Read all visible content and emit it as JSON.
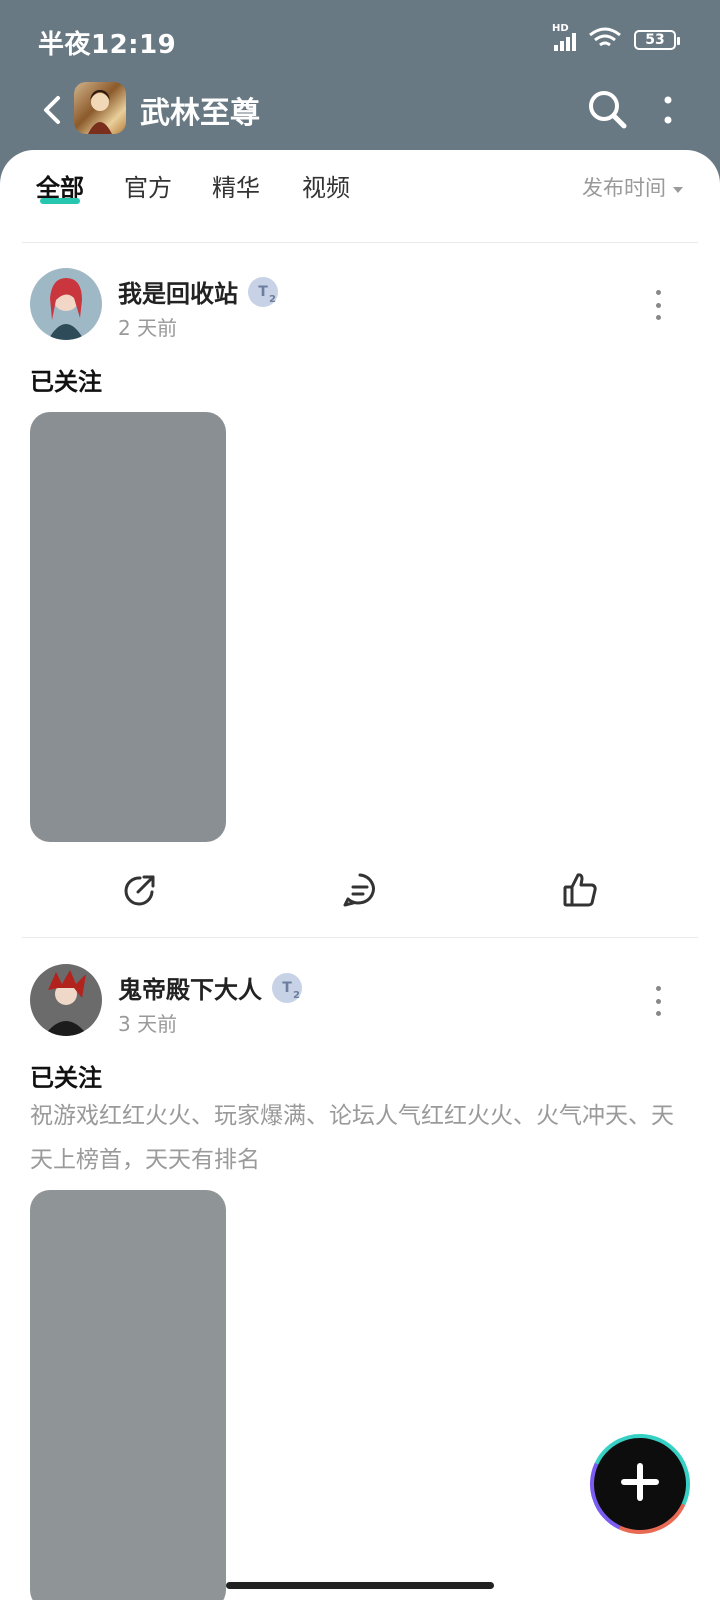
{
  "status_bar": {
    "time": "半夜12:19",
    "network": "HD",
    "battery": "53"
  },
  "header": {
    "title": "武林至尊",
    "back_icon": "back-arrow-icon",
    "search_icon": "search-icon",
    "more_icon": "more-vertical-icon"
  },
  "tabs": [
    {
      "label": "全部",
      "active": true
    },
    {
      "label": "官方",
      "active": false
    },
    {
      "label": "精华",
      "active": false
    },
    {
      "label": "视频",
      "active": false
    }
  ],
  "sort": {
    "label": "发布时间",
    "icon": "caret-down-icon"
  },
  "accent_color": "#26c6b0",
  "posts": [
    {
      "username": "我是回收站",
      "badge": "T",
      "badge_sub": "2",
      "time": "2 天前",
      "follow_label": "已关注",
      "body": "",
      "actions": [
        "share-icon",
        "comment-icon",
        "like-icon"
      ]
    },
    {
      "username": "鬼帝殿下大人",
      "badge": "T",
      "badge_sub": "2",
      "time": "3 天前",
      "follow_label": "已关注",
      "body": "祝游戏红红火火、玩家爆满、论坛人气红红火火、火气冲天、天天上榜首，天天有排名",
      "actions": [
        "share-icon",
        "comment-icon",
        "like-icon"
      ]
    }
  ],
  "fab": {
    "icon": "plus-icon"
  }
}
